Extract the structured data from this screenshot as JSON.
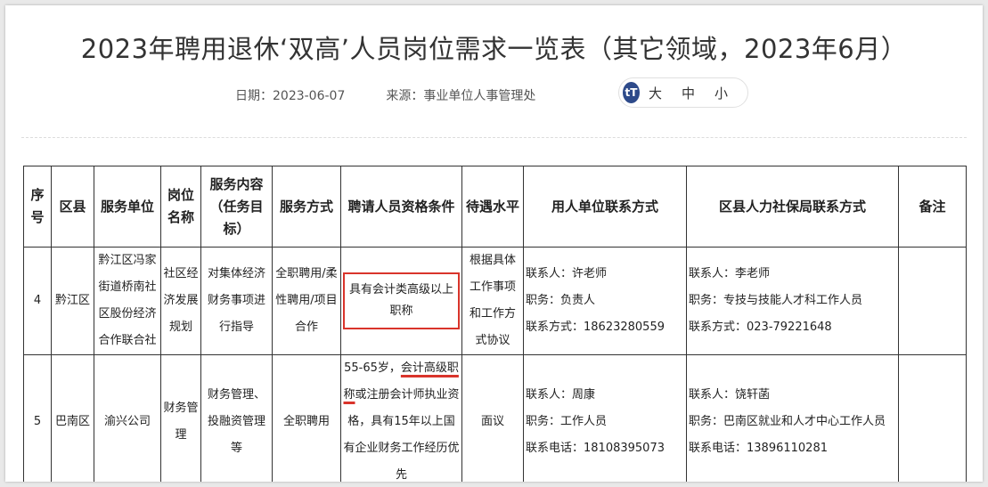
{
  "title": "2023年聘用退休‘双高’人员岗位需求一览表（其它领域，2023年6月）",
  "meta": {
    "date_label": "日期：",
    "date": "2023-06-07",
    "source_label": "来源：",
    "source": "事业单位人事管理处"
  },
  "font_control": {
    "icon": "tT",
    "large": "大",
    "medium": "中",
    "small": "小"
  },
  "table": {
    "headers": [
      "序号",
      "区县",
      "服务单位",
      "岗位名称",
      "服务内容（任务目标）",
      "服务方式",
      "聘请人员资格条件",
      "待遇水平",
      "用人单位联系方式",
      "区县人力社保局联系方式",
      "备注"
    ],
    "rows": [
      {
        "no": "4",
        "district": "黔江区",
        "unit": "黔江区冯家街道桥南社区股份经济合作联合社",
        "post": "社区经济发展规划",
        "content": "对集体经济财务事项进行指导",
        "mode": "全职聘用/柔性聘用/项目合作",
        "requirement": "具有会计类高级以上职称",
        "pay": "根据具体工作事项和工作方式协议",
        "employer_contact": [
          "联系人：许老师",
          "职务：负责人",
          "联系方式：18623280559"
        ],
        "bureau_contact": [
          "联系人：李老师",
          "职务：专技与技能人才科工作人员",
          "联系方式：023-79221648"
        ],
        "note": ""
      },
      {
        "no": "5",
        "district": "巴南区",
        "unit": "渝兴公司",
        "post": "财务管理",
        "content": "财务管理、投融资管理等",
        "mode": "全职聘用",
        "requirement_a": "55-65岁，",
        "requirement_b": "会计高级职称",
        "requirement_c": "或注册会计师执业资格，具有15年以上国有企业财务工作经历优先",
        "pay": "面议",
        "employer_contact": [
          "联系人：周康",
          "职务：工作人员",
          "联系电话：18108395073"
        ],
        "bureau_contact": [
          "联系人：饶轩菡",
          "职务：巴南区就业和人才中心工作人员",
          "联系电话：13896110281"
        ],
        "note": ""
      }
    ]
  }
}
